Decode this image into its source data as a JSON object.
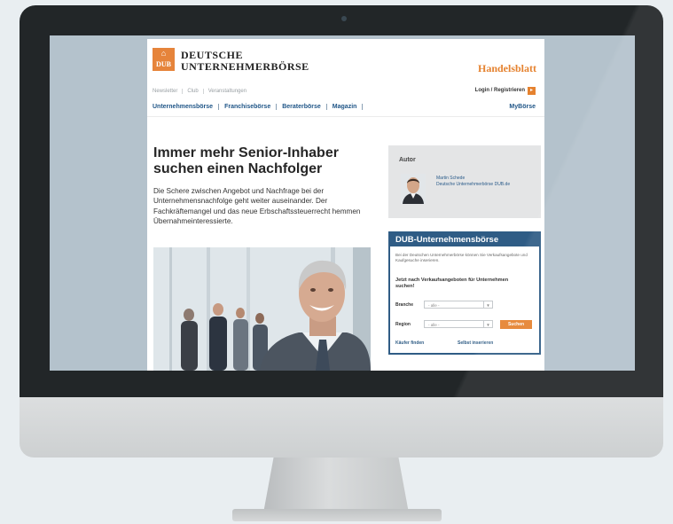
{
  "site": {
    "logo_badge": "DUB",
    "logo_line1": "DEUTSCHE",
    "logo_line2": "UNTERNEHMERBÖRSE",
    "partner": "Handelsblatt"
  },
  "topnav": [
    "Newsletter",
    "Club",
    "Veranstaltungen"
  ],
  "login_label": "Login / Registrieren",
  "mainnav": [
    "Unternehmensbörse",
    "Franchisebörse",
    "Beraterbörse",
    "Magazin"
  ],
  "mainnav_right": "MyBörse",
  "article": {
    "headline": "Immer mehr Senior-Inhaber suchen einen Nachfolger",
    "lead": "Die Schere zwischen Angebot und Nachfrage bei der Unternehmensnachfolge geht weiter auseinander. Der Fachkräftemangel und das neue Erbschaftssteuerrecht hemmen Übernahmeinteressierte."
  },
  "author": {
    "title": "Autor",
    "name": "Martin Schede",
    "org": "Deutsche Unternehmerbörse DUB.de"
  },
  "dub": {
    "title": "DUB-Unternehmensbörse",
    "intro": "Bei der Deutschen Unternehmerbörse können Sie Verkaufsangebote und Kaufgesuche inserieren.",
    "cta": "Jetzt nach Verkaufsangeboten für Unternehmen suchen!",
    "branche_label": "Branche",
    "branche_value": "- alle -",
    "region_label": "Region",
    "region_value": "- alle -",
    "search_button": "Suchen",
    "link_buyer": "Käufer finden",
    "link_insert": "Selbst inserieren"
  },
  "colors": {
    "accent_orange": "#e5822f",
    "brand_blue": "#2f5c85",
    "bezel": "#222628"
  }
}
